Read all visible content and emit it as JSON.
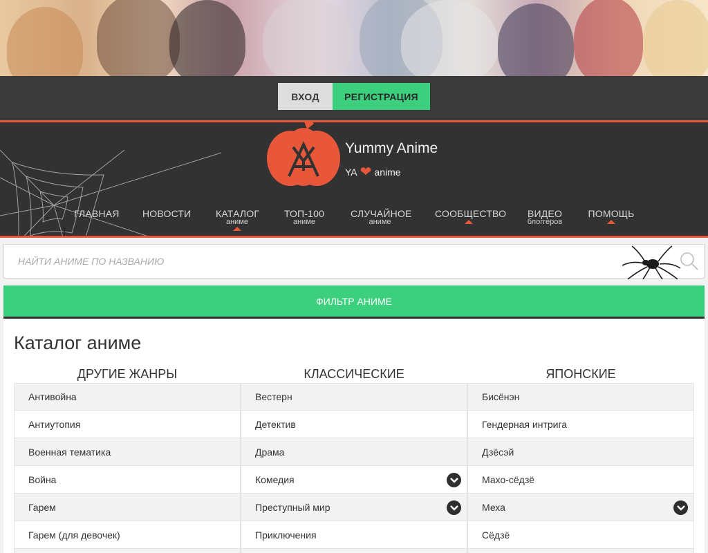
{
  "auth": {
    "login_label": "ВХОД",
    "register_label": "РЕГИСТРАЦИЯ"
  },
  "brand": {
    "title": "Yummy Anime",
    "tagline_left": "YA",
    "tagline_right": "anime",
    "accent": "#e8573a",
    "green": "#3ccf7d"
  },
  "nav": [
    {
      "label": "ГЛАВНАЯ",
      "sub": ""
    },
    {
      "label": "НОВОСТИ",
      "sub": ""
    },
    {
      "label": "КАТАЛОГ",
      "sub": "аниме"
    },
    {
      "label": "ТОП-100",
      "sub": "аниме"
    },
    {
      "label": "СЛУЧАЙНОЕ",
      "sub": "аниме"
    },
    {
      "label": "СООБЩЕСТВО",
      "sub": ""
    },
    {
      "label": "ВИДЕО",
      "sub": "блоггеров"
    },
    {
      "label": "ПОМОЩЬ",
      "sub": ""
    }
  ],
  "search": {
    "placeholder": "НАЙТИ АНИМЕ ПО НАЗВАНИЮ"
  },
  "filter": {
    "label": "ФИЛЬТР АНИМЕ"
  },
  "catalog": {
    "title": "Каталог аниме",
    "columns": [
      {
        "heading": "ДРУГИЕ ЖАНРЫ",
        "items": [
          "Антивойна",
          "Антиутопия",
          "Военная тематика",
          "Война",
          "Гарем",
          "Гарем (для девочек)",
          ""
        ]
      },
      {
        "heading": "КЛАССИЧЕСКИЕ",
        "items": [
          "Вестерн",
          "Детектив",
          "Драма",
          "Комедия",
          "Преступный мир",
          "Приключения",
          ""
        ]
      },
      {
        "heading": "ЯПОНСКИЕ",
        "items": [
          "Бисёнэн",
          "Гендерная интрига",
          "Дзёсэй",
          "Махо-сёдзё",
          "Меха",
          "Сёдзё",
          ""
        ]
      }
    ]
  }
}
